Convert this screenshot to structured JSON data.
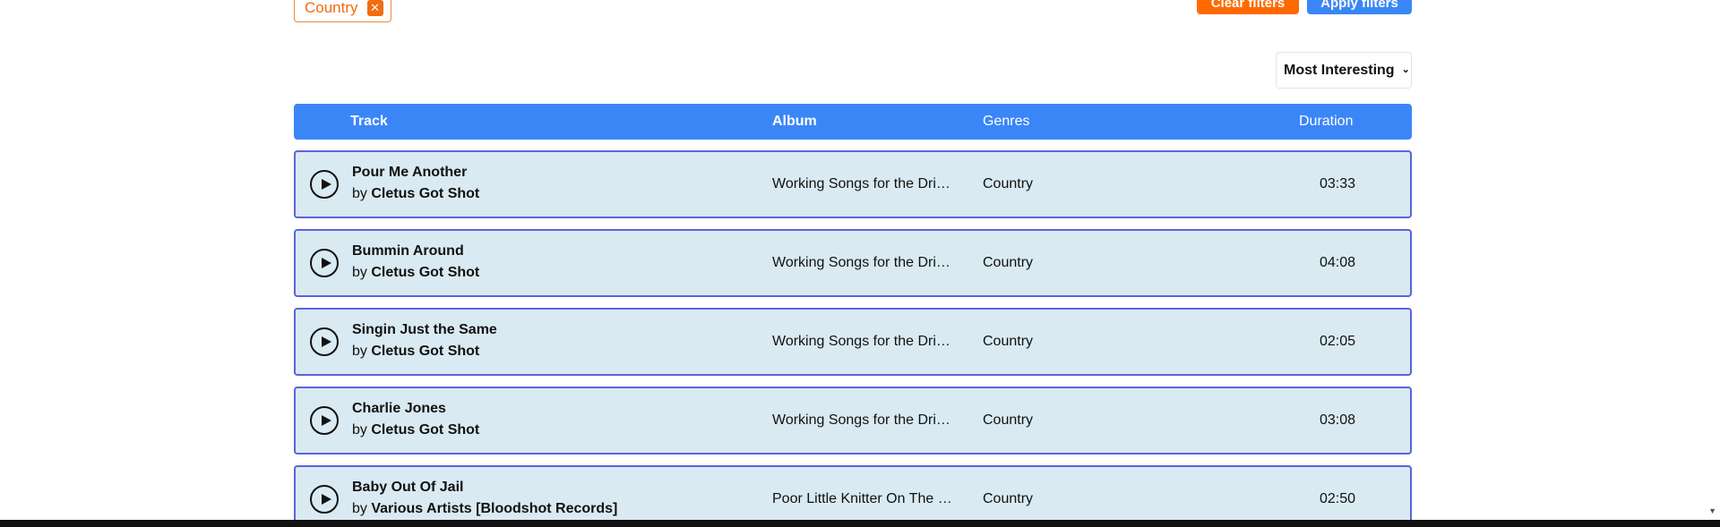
{
  "filters": {
    "chip_label": "Country",
    "chip_remove": "✕",
    "clear_label": "Clear filters",
    "apply_label": "Apply filters"
  },
  "sort": {
    "selected": "Most Interesting",
    "chevron": "⌄"
  },
  "table": {
    "headers": {
      "track": "Track",
      "album": "Album",
      "genres": "Genres",
      "duration": "Duration"
    },
    "rows": [
      {
        "title": "Pour Me Another",
        "by_prefix": "by",
        "artist": "Cletus Got Shot",
        "album": "Working Songs for the Drinking Class",
        "genre": "Country",
        "duration": "03:33"
      },
      {
        "title": "Bummin Around",
        "by_prefix": "by",
        "artist": "Cletus Got Shot",
        "album": "Working Songs for the Drinking Class",
        "genre": "Country",
        "duration": "04:08"
      },
      {
        "title": "Singin Just the Same",
        "by_prefix": "by",
        "artist": "Cletus Got Shot",
        "album": "Working Songs for the Drinking Class",
        "genre": "Country",
        "duration": "02:05"
      },
      {
        "title": "Charlie Jones",
        "by_prefix": "by",
        "artist": "Cletus Got Shot",
        "album": "Working Songs for the Drinking Class",
        "genre": "Country",
        "duration": "03:08"
      },
      {
        "title": "Baby Out Of Jail",
        "by_prefix": "by",
        "artist": "Various Artists [Bloodshot Records]",
        "album": "Poor Little Knitter On The Road",
        "genre": "Country",
        "duration": "02:50"
      }
    ]
  },
  "colors": {
    "accent_blue": "#3a86f7",
    "accent_orange": "#ff6a00",
    "row_bg": "#daeaf2",
    "row_border": "#5b63e0"
  },
  "icons": {
    "play": "play-icon",
    "remove": "close-icon",
    "chevron": "chevron-down-icon"
  }
}
